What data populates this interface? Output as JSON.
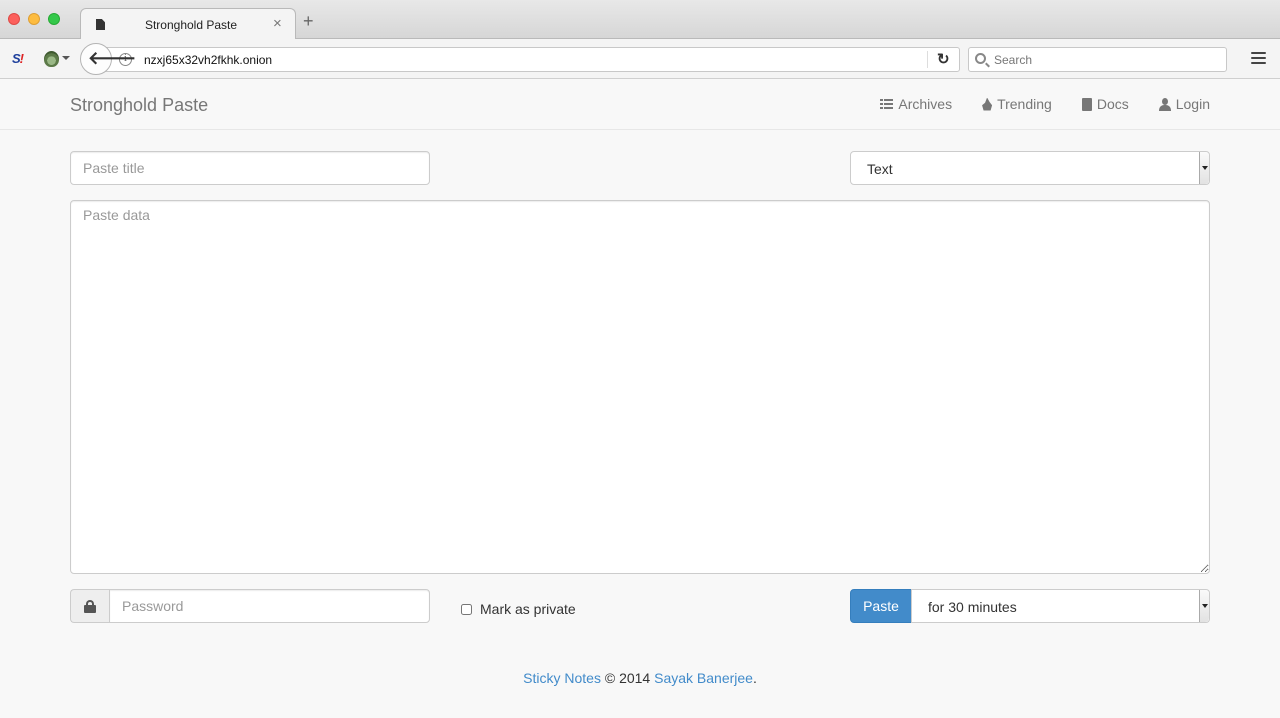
{
  "browser": {
    "tab_title": "Stronghold Paste",
    "tab_close": "×",
    "new_tab": "+",
    "url": "nzxj65x32vh2fkhk.onion",
    "search_placeholder": "Search",
    "info_glyph": "i",
    "back_glyph": "🡐",
    "reload_glyph": "↻",
    "ext_logo": {
      "s": "S",
      "slash": "!"
    }
  },
  "site": {
    "brand": "Stronghold Paste",
    "nav": [
      {
        "label": "Archives",
        "icon": "list-icon"
      },
      {
        "label": "Trending",
        "icon": "fire-icon"
      },
      {
        "label": "Docs",
        "icon": "book-icon"
      },
      {
        "label": "Login",
        "icon": "user-icon"
      }
    ]
  },
  "form": {
    "title_placeholder": "Paste title",
    "language_selected": "Text",
    "data_placeholder": "Paste data",
    "password_placeholder": "Password",
    "private_label": "Mark as private",
    "paste_button": "Paste",
    "expire_selected": "for 30 minutes"
  },
  "footer": {
    "link1": "Sticky Notes",
    "copyright": " © 2014 ",
    "link2": "Sayak Banerjee",
    "end": "."
  },
  "colors": {
    "primary": "#428bca",
    "nav_text": "#777777"
  }
}
